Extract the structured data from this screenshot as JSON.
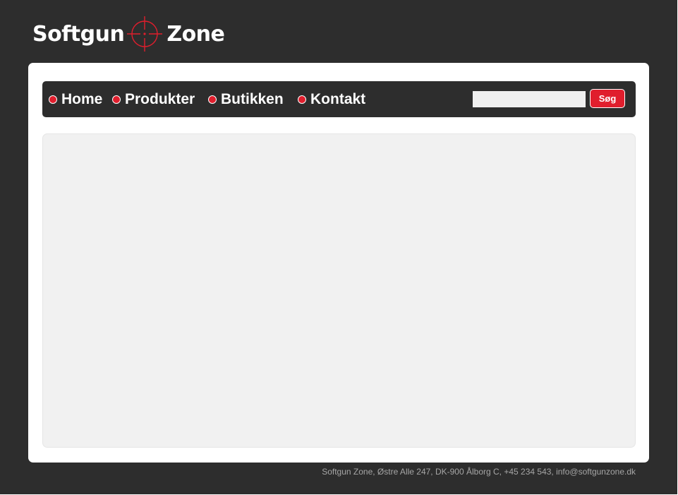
{
  "logo": {
    "text_left": "Softgun",
    "text_right": "Zone",
    "icon": "crosshair-icon"
  },
  "nav": {
    "items": [
      {
        "label": "Home"
      },
      {
        "label": "Produkter"
      },
      {
        "label": "Butikken"
      },
      {
        "label": "Kontakt"
      }
    ],
    "bullet_icon": "red-dot-icon"
  },
  "search": {
    "value": "",
    "button_label": "Søg"
  },
  "footer": {
    "text": "Softgun Zone, Østre Alle 247, DK-900 Ålborg C, +45 234 543, info@softgunzone.dk"
  },
  "colors": {
    "background": "#2d2d2d",
    "panel": "#ffffff",
    "content": "#f1f1f1",
    "accent": "#e01e2d",
    "footer_text": "#a6a6a6"
  }
}
